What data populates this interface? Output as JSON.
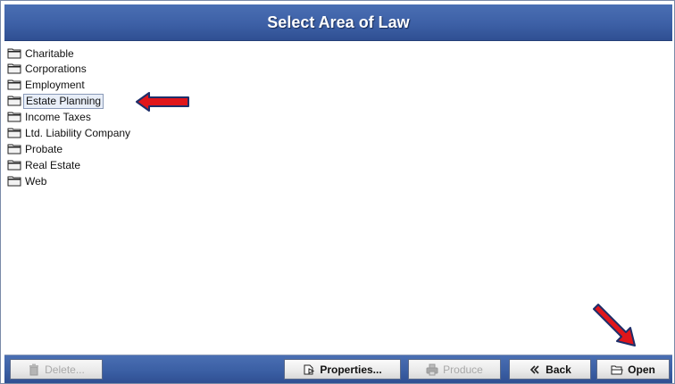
{
  "window": {
    "title": "Select Area of Law"
  },
  "list": {
    "items": [
      {
        "label": "Charitable"
      },
      {
        "label": "Corporations"
      },
      {
        "label": "Employment"
      },
      {
        "label": "Estate Planning",
        "selected": true
      },
      {
        "label": "Income Taxes"
      },
      {
        "label": "Ltd. Liability Company"
      },
      {
        "label": "Probate"
      },
      {
        "label": "Real Estate"
      },
      {
        "label": "Web"
      }
    ]
  },
  "toolbar": {
    "delete_label": "Delete...",
    "properties_label": "Properties...",
    "produce_label": "Produce",
    "back_label": "Back",
    "open_label": "Open"
  },
  "colors": {
    "title_bar": "#3d60a6",
    "annotation_arrow": "#e0161b"
  },
  "icons": [
    "folder-icon",
    "trash-icon",
    "properties-icon",
    "printer-icon",
    "back-chevron-icon",
    "open-folder-icon",
    "red-arrow-left-icon",
    "red-arrow-down-right-icon"
  ]
}
